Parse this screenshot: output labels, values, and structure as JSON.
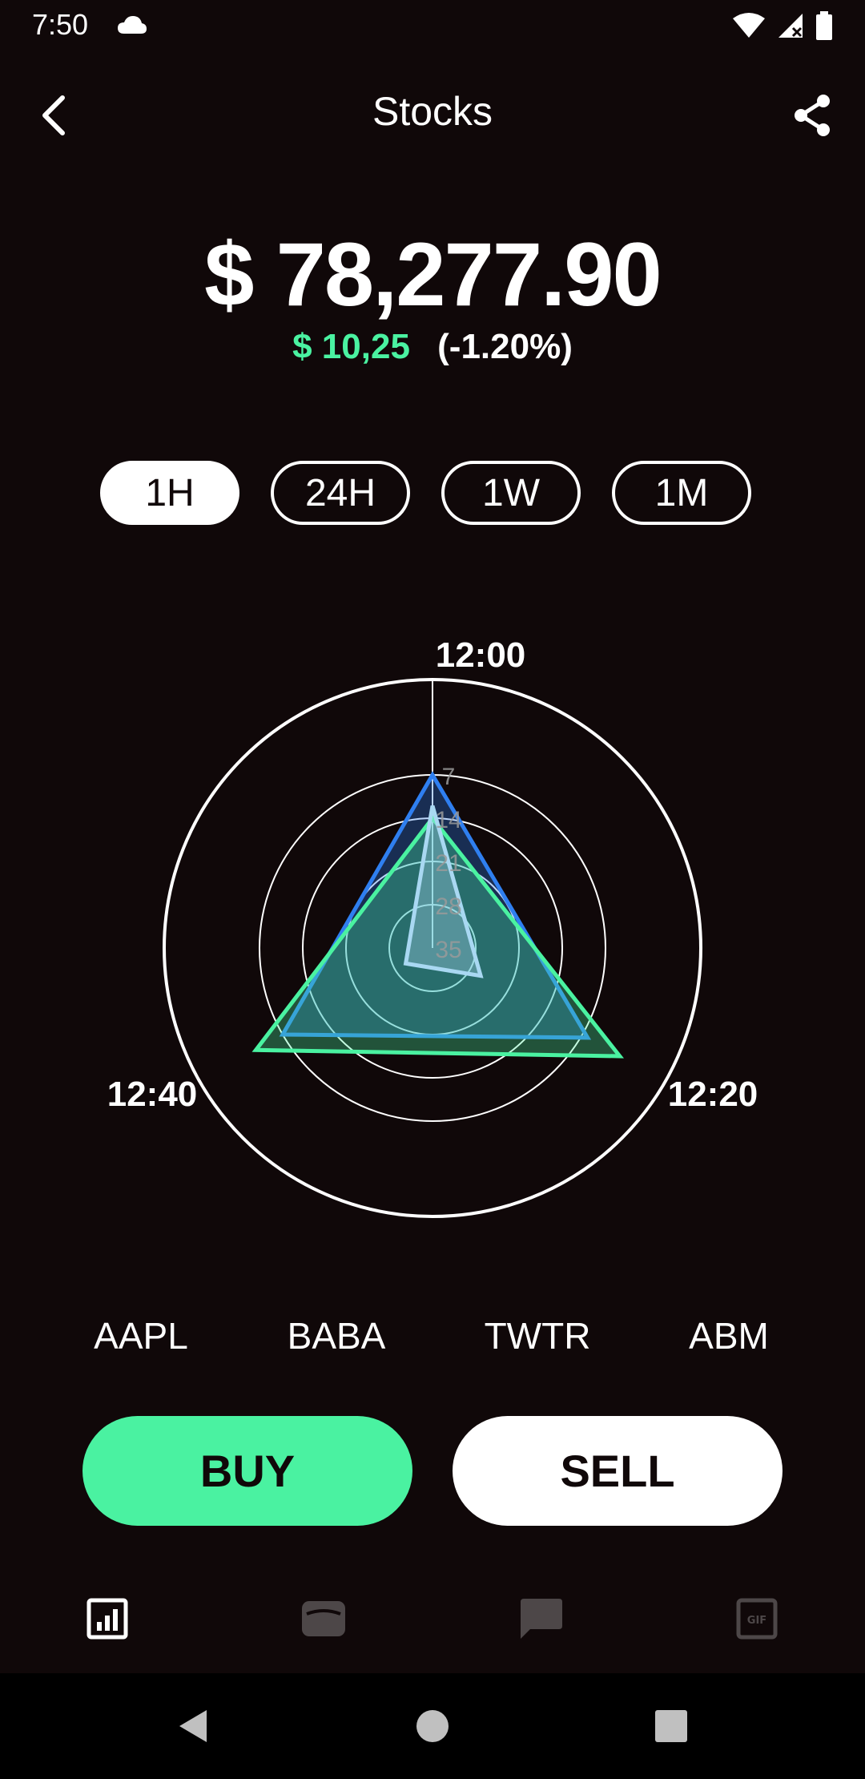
{
  "status_bar": {
    "time": "7:50",
    "icons": [
      "cloud-icon",
      "wifi-icon",
      "cell-signal-icon",
      "battery-icon"
    ]
  },
  "app_bar": {
    "title": "Stocks",
    "back_icon": "chevron-left-icon",
    "share_icon": "share-icon"
  },
  "portfolio": {
    "balance": "$ 78,277.90",
    "change_amount": "$ 10,25",
    "change_percent": "(-1.20%)"
  },
  "period_tabs": [
    {
      "label": "1H",
      "active": true
    },
    {
      "label": "24H",
      "active": false
    },
    {
      "label": "1W",
      "active": false
    },
    {
      "label": "1M",
      "active": false
    }
  ],
  "chart_data": {
    "type": "radar",
    "axes": [
      "12:00",
      "12:20",
      "12:40"
    ],
    "radial_ticks": [
      7,
      14,
      21,
      28,
      35
    ],
    "radial_range": [
      35,
      0
    ],
    "grid": true,
    "series": [
      {
        "color": "#2f7ff0",
        "values": [
          7,
          6,
          7
        ]
      },
      {
        "color": "#4af2a1",
        "values": [
          14,
          0,
          2
        ]
      },
      {
        "color": "#a9d8f2",
        "values": [
          12,
          26,
          30
        ]
      }
    ]
  },
  "tickers": [
    "AAPL",
    "BABA",
    "TWTR",
    "ABM"
  ],
  "actions": {
    "buy_label": "BUY",
    "sell_label": "SELL"
  },
  "bottom_nav": [
    {
      "icon": "chart-icon",
      "active": true
    },
    {
      "icon": "wallet-icon",
      "active": false
    },
    {
      "icon": "chat-icon",
      "active": false
    },
    {
      "icon": "gif-icon",
      "active": false
    }
  ],
  "colors": {
    "background": "#100809",
    "accent_green": "#4af2a1",
    "series_blue": "#2f7ff0",
    "series_light": "#a9d8f2"
  },
  "system_nav": [
    "back-triangle-icon",
    "home-circle-icon",
    "recents-square-icon"
  ]
}
